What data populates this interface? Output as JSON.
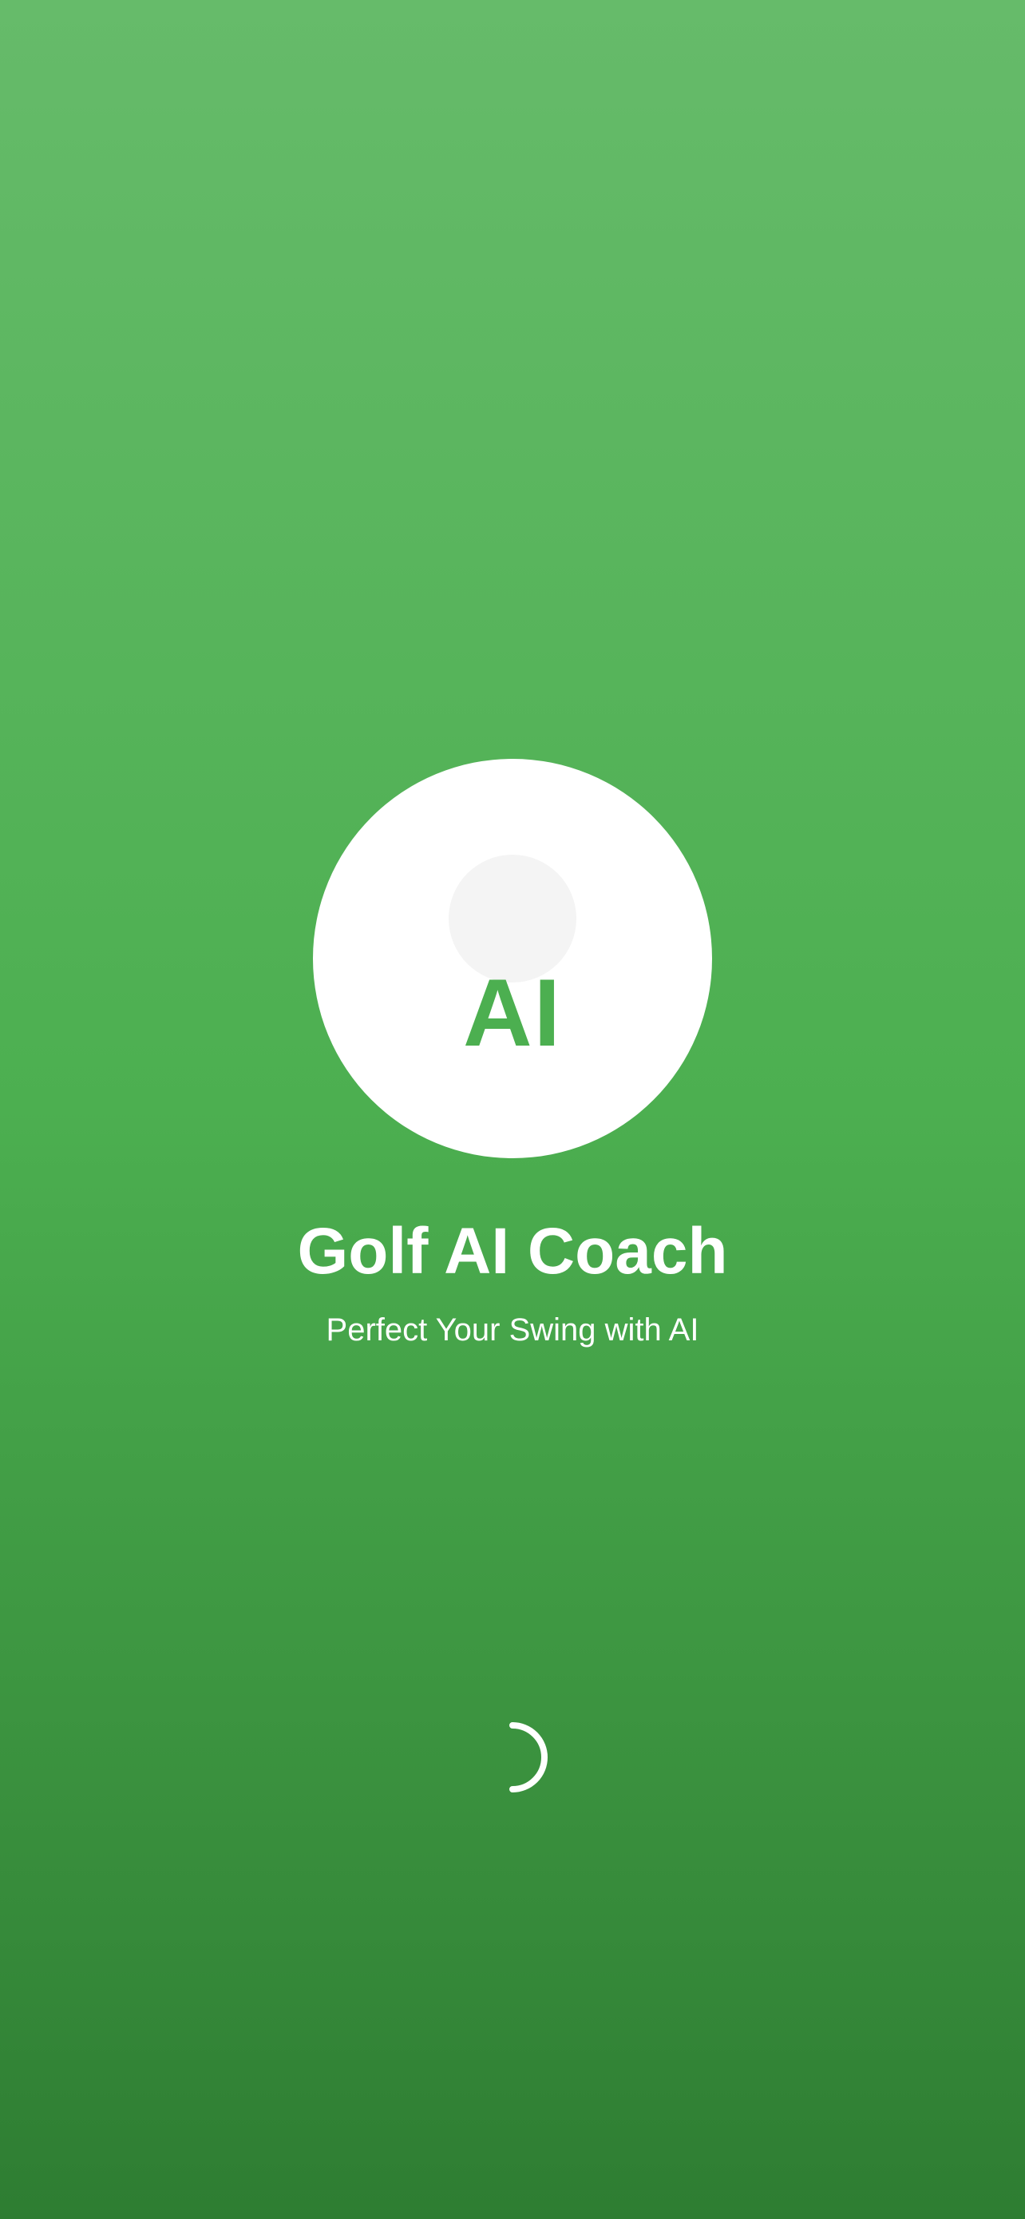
{
  "app": {
    "logo_text": "AI",
    "title": "Golf AI Coach",
    "subtitle": "Perfect Your Swing with AI"
  },
  "colors": {
    "gradient_top": "#66bb6a",
    "gradient_mid": "#4caf50",
    "gradient_bottom": "#2e7d32",
    "logo_background": "#ffffff",
    "logo_text": "#4caf50",
    "logo_ball": "#f4f4f4",
    "text": "#ffffff"
  },
  "icons": {
    "logo_ball": "golf-ball-icon",
    "loading": "loading-spinner"
  }
}
